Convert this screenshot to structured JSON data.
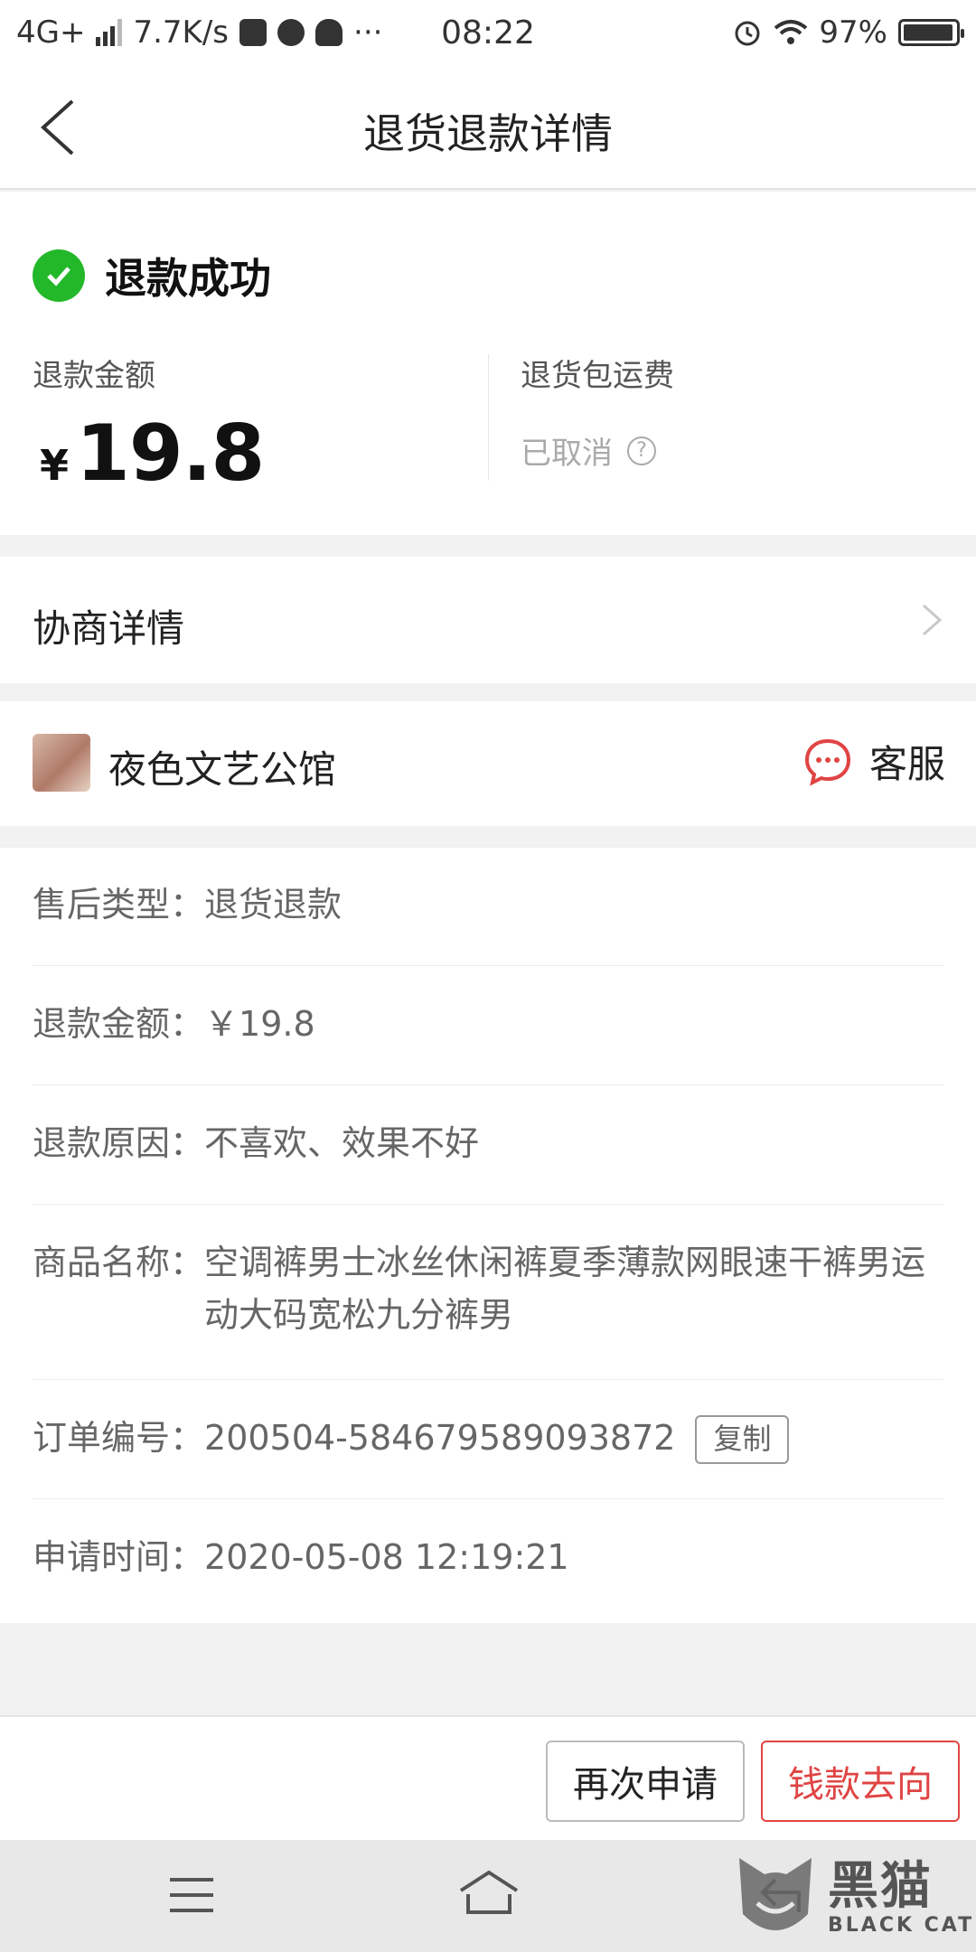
{
  "status_bar": {
    "network": "4G+",
    "speed": "7.7K/s",
    "more": "···",
    "time": "08:22",
    "battery": "97%",
    "battery_level": 0.97,
    "icons": [
      "signal-icon",
      "taobao-icon",
      "wechat-icon",
      "qq-icon",
      "alarm-icon",
      "wifi-icon",
      "battery-icon"
    ]
  },
  "nav": {
    "title": "退货退款详情"
  },
  "status": {
    "text": "退款成功",
    "color": "#22b829"
  },
  "amount": {
    "label": "退款金额",
    "currency": "¥",
    "value": "19.8"
  },
  "shipping": {
    "label": "退货包运费",
    "value": "已取消",
    "help": "?"
  },
  "negotiation": {
    "label": "协商详情"
  },
  "shop": {
    "name": "夜色文艺公馆",
    "service_label": "客服",
    "service_color": "#e04444"
  },
  "details": [
    {
      "key": "售后类型：",
      "value": "退货退款"
    },
    {
      "key": "退款金额：",
      "value": "￥19.8"
    },
    {
      "key": "退款原因：",
      "value": "不喜欢、效果不好"
    },
    {
      "key": "商品名称：",
      "value": "空调裤男士冰丝休闲裤夏季薄款网眼速干裤男运动大码宽松九分裤男"
    },
    {
      "key": "订单编号：",
      "value": "200504-584679589093872",
      "action": "复制"
    },
    {
      "key": "申请时间：",
      "value": "2020-05-08 12:19:21"
    }
  ],
  "actions": {
    "reapply": "再次申请",
    "money_flow": "钱款去向",
    "accent": "#e04444"
  },
  "watermark": {
    "cn": "黑猫",
    "en": "BLACK CAT"
  }
}
